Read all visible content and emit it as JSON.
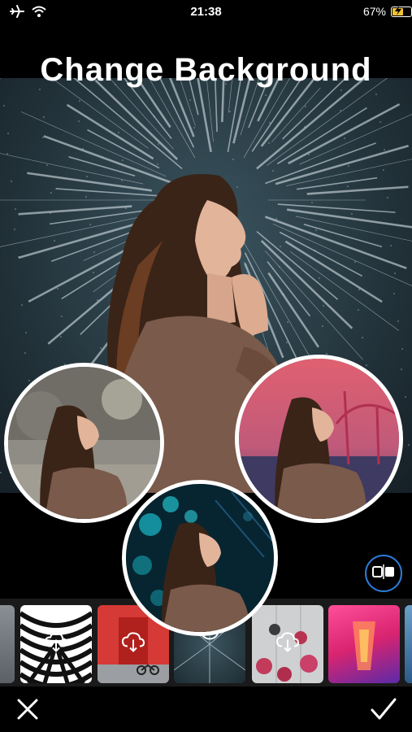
{
  "status_bar": {
    "time": "21:38",
    "battery_percent": "67%",
    "battery_level": 0.67,
    "icons": [
      "airplane-icon",
      "wifi-icon",
      "charging-icon"
    ]
  },
  "title": "Change Background",
  "previews": [
    "concrete-wall-background",
    "bridge-sunset-background",
    "bokeh-lights-background"
  ],
  "thumbnails": [
    {
      "name": "partial-grey",
      "icon": ""
    },
    {
      "name": "zebra-pattern",
      "icon": "cloud-download-icon"
    },
    {
      "name": "red-door",
      "icon": "cloud-download-icon"
    },
    {
      "name": "starburst-selected",
      "icon": "bookmark-icon"
    },
    {
      "name": "pink-flowers",
      "icon": "cloud-download-icon"
    },
    {
      "name": "neon-corridor",
      "icon": ""
    },
    {
      "name": "partial-blue",
      "icon": ""
    }
  ],
  "colors": {
    "accent": "#2e7bd6",
    "battery": "#f2c230",
    "background": "#000000"
  }
}
